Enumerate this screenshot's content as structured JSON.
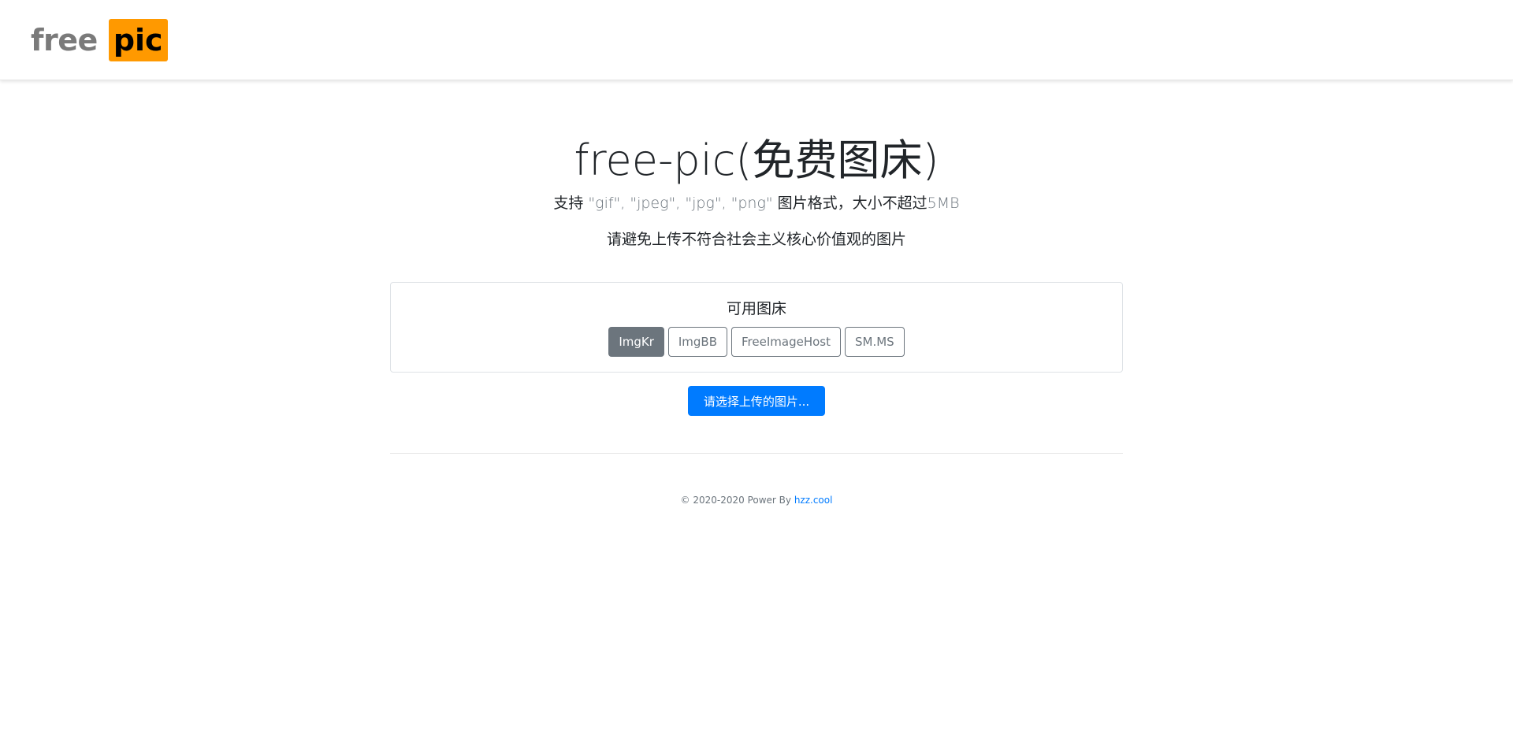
{
  "header": {
    "logo": {
      "part1": "free",
      "part2": "pic"
    }
  },
  "hero": {
    "title": "free-pic(免费图床)",
    "subtitle_prefix": "支持 ",
    "formats": "\"gif\", \"jpeg\", \"jpg\", \"png\"",
    "subtitle_middle": " 图片格式，大小不超过",
    "max_size": "5MB",
    "notice": "请避免上传不符合社会主义核心价值观的图片"
  },
  "hosts": {
    "title": "可用图床",
    "items": [
      {
        "label": "ImgKr",
        "active": true
      },
      {
        "label": "ImgBB",
        "active": false
      },
      {
        "label": "FreeImageHost",
        "active": false
      },
      {
        "label": "SM.MS",
        "active": false
      }
    ]
  },
  "upload": {
    "label": "请选择上传的图片..."
  },
  "footer": {
    "copyright": "© 2020-2020 Power By ",
    "link_text": "hzz.cool"
  },
  "colors": {
    "brand_orange": "#ff9900",
    "primary_blue": "#007bff",
    "secondary_gray": "#6c757d"
  }
}
